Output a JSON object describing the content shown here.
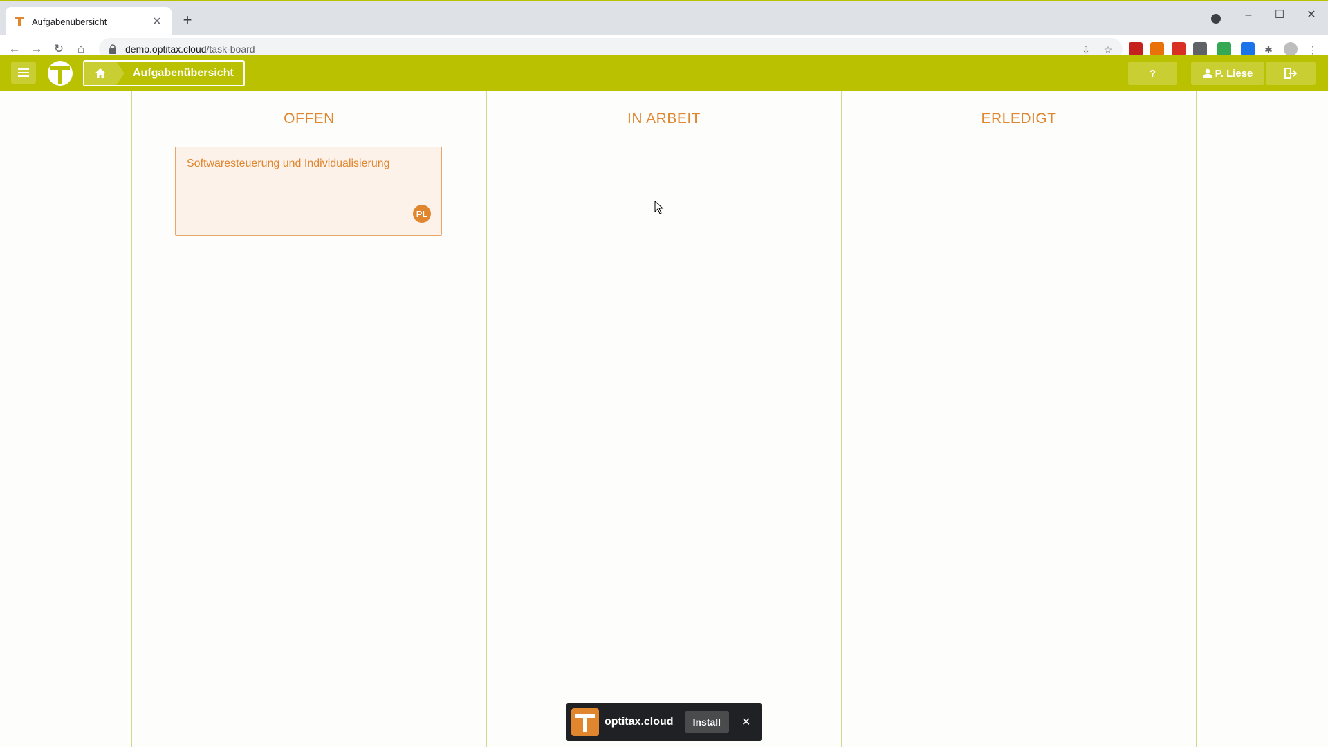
{
  "browser": {
    "tab_title": "Aufgabenübersicht",
    "tab_close": "✕",
    "new_tab": "+",
    "url_host": "demo.optitax.cloud",
    "url_path": "/task-board",
    "win_minimize": "–",
    "win_maximize": "☐",
    "win_close": "✕"
  },
  "header": {
    "breadcrumb": "Aufgabenübersicht",
    "help_label": "?",
    "user_label": "P. Liese"
  },
  "board": {
    "columns": [
      {
        "title": "OFFEN"
      },
      {
        "title": "IN ARBEIT"
      },
      {
        "title": "ERLEDIGT"
      }
    ],
    "cards": [
      {
        "title": "Softwaresteuerung und Individualisierung",
        "assignee": "PL"
      }
    ]
  },
  "install_prompt": {
    "app_name": "optitax.cloud",
    "install_label": "Install",
    "close_label": "✕"
  },
  "colors": {
    "brand_green": "#b9c100",
    "accent_orange": "#e0862e"
  }
}
